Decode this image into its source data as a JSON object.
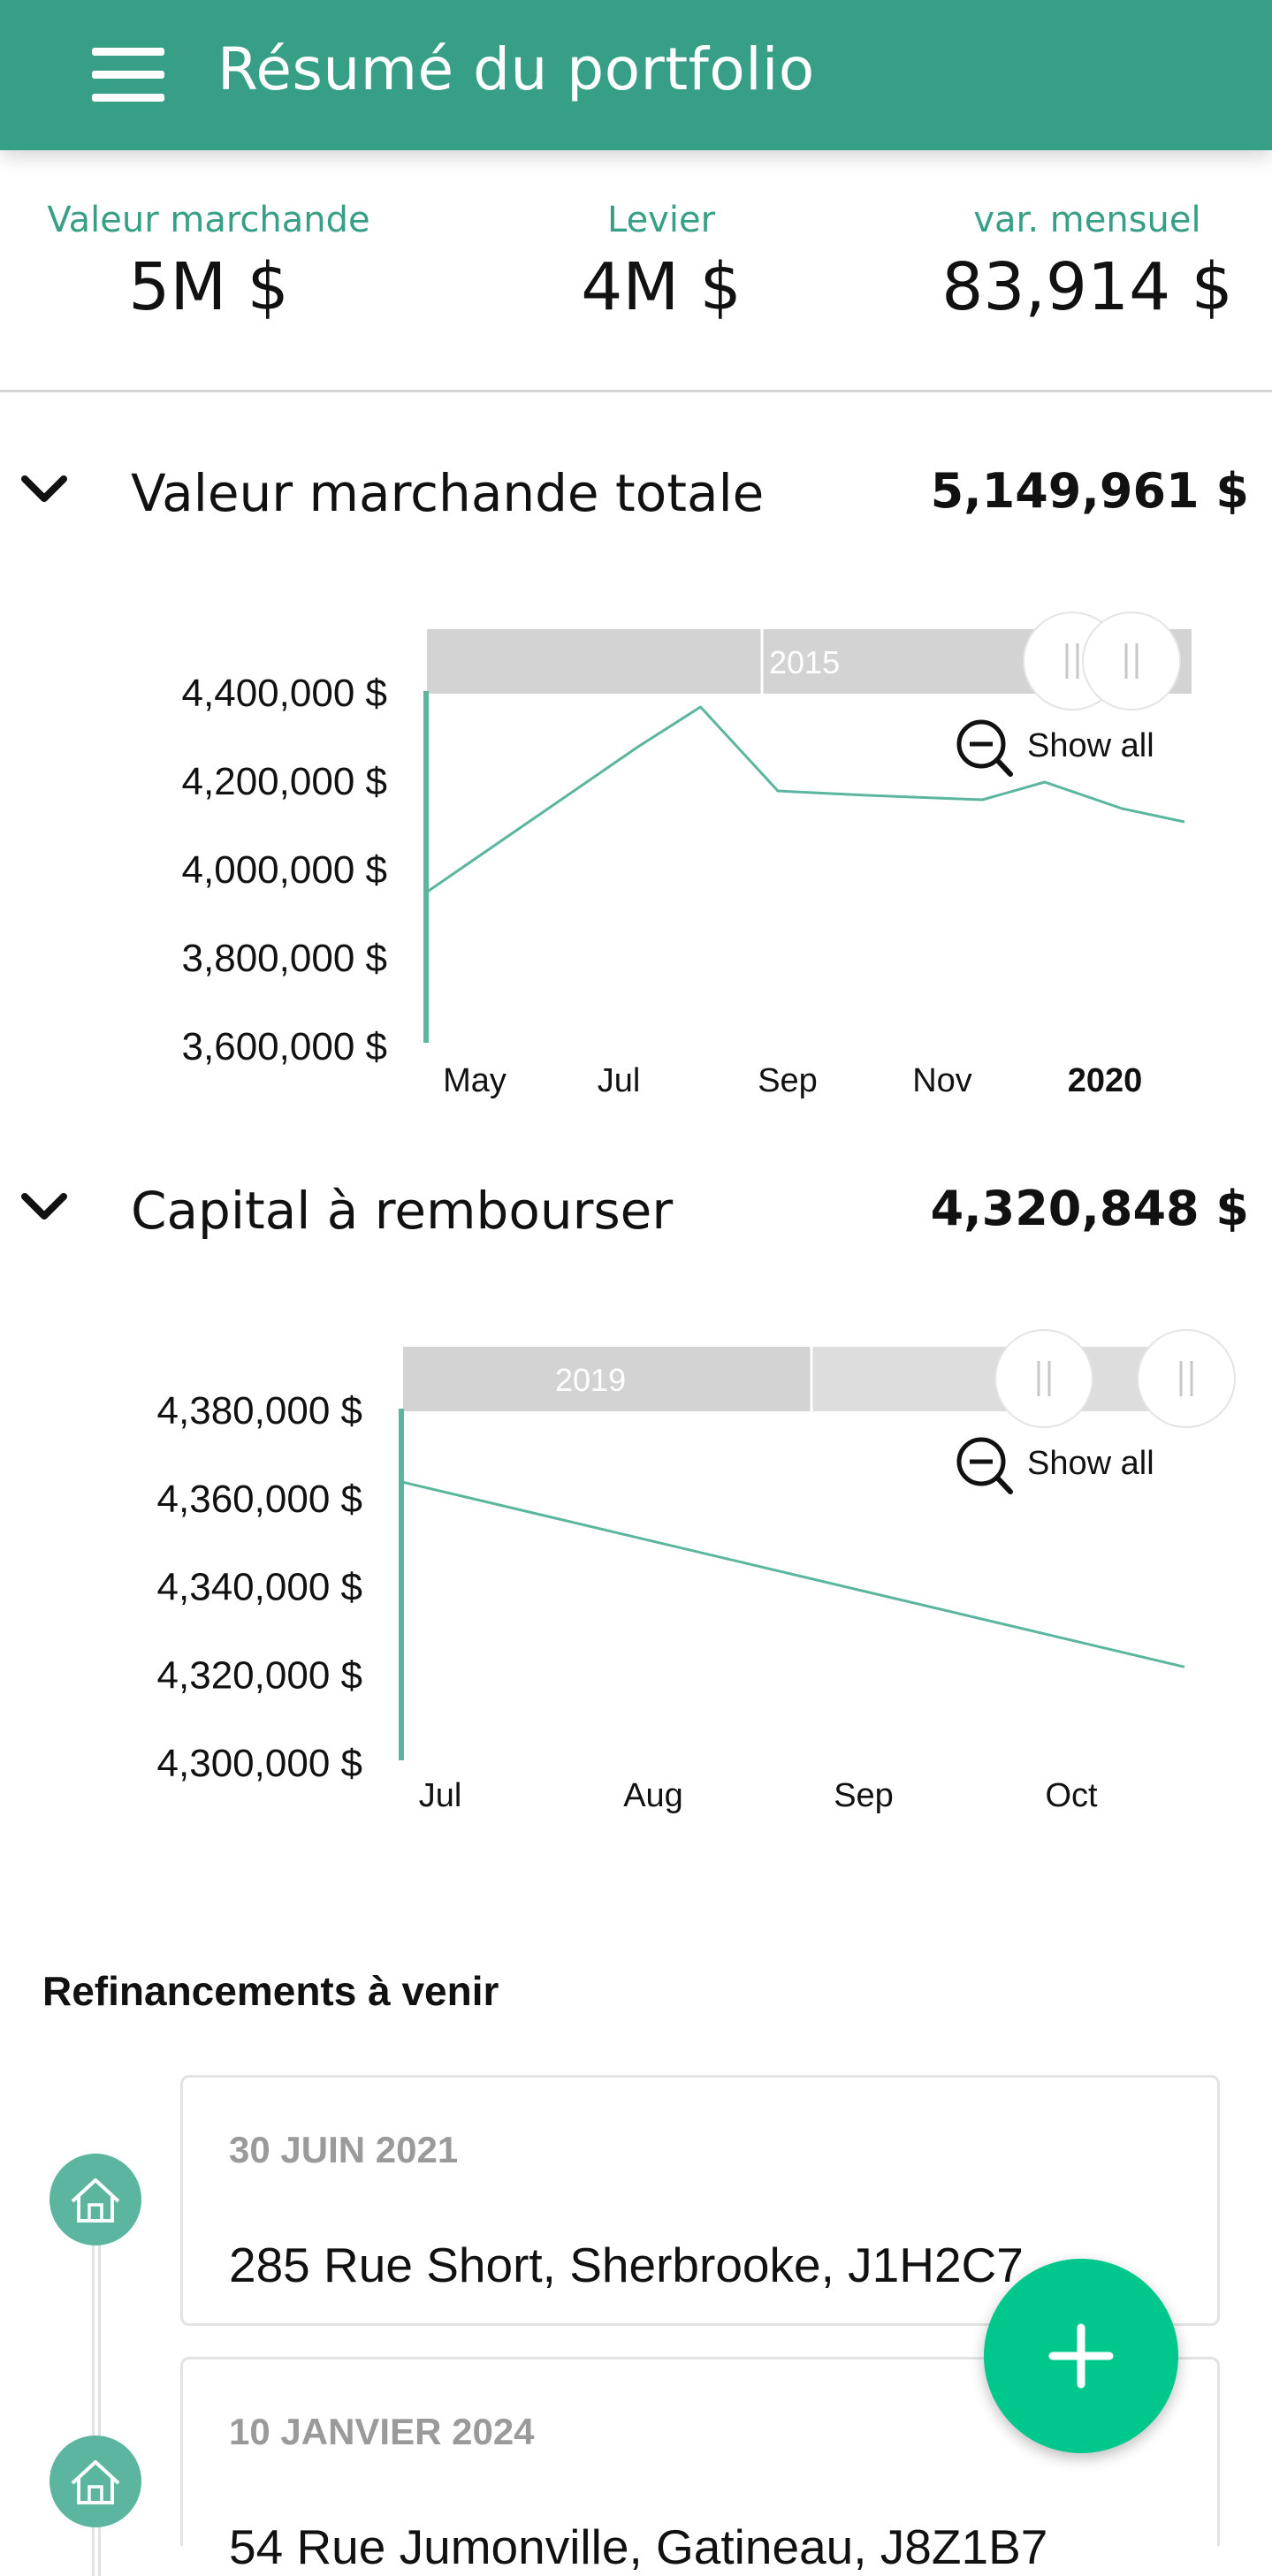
{
  "appbar": {
    "title": "Résumé du portfolio",
    "menu_icon": "menu-icon"
  },
  "summary": [
    {
      "label": "Valeur marchande",
      "value": "5M $"
    },
    {
      "label": "Levier",
      "value": "4M $"
    },
    {
      "label": "var. mensuel",
      "value": "83,914 $"
    }
  ],
  "sections": [
    {
      "title": "Valeur marchande totale",
      "value": "5,149,961 $"
    },
    {
      "title": "Capital à rembourser",
      "value": "4,320,848 $"
    }
  ],
  "colors": {
    "brand": "#369f86",
    "line": "#5bb59f",
    "fab": "#00c88c",
    "navigator": "#d3d3d3"
  },
  "chart_data": [
    {
      "type": "line",
      "title": "",
      "series": [
        {
          "values": [
            3950000,
            4280000,
            4370000,
            4180000,
            4170000,
            4160000,
            4200000,
            4140000,
            4110000
          ]
        }
      ],
      "x": [
        "Apr 1, 2019",
        "Jun 25, 2019",
        "Jul 20, 2019",
        "Aug 20, 2019",
        "Sep 25, 2019",
        "Nov 10, 2019",
        "Dec 5, 2019",
        "Jan 5, 2020",
        "Jan 30, 2020"
      ],
      "x_ticks": [
        "May",
        "Jul",
        "Sep",
        "Nov",
        "2020"
      ],
      "y_ticks": [
        "4,400,000 $",
        "4,200,000 $",
        "4,000,000 $",
        "3,800,000 $",
        "3,600,000 $"
      ],
      "y_tick_values": [
        4400000,
        4200000,
        4000000,
        3800000,
        3600000
      ],
      "ylim": [
        3600000,
        4400000
      ],
      "navigator_label": "2015",
      "zoom_label": "Show all",
      "zoom_icon": "zoom-out-icon"
    },
    {
      "type": "line",
      "title": "",
      "series": [
        {
          "values": [
            4364000,
            4322000
          ]
        }
      ],
      "x": [
        "Jul 1, 2019",
        "Oct 25, 2019"
      ],
      "x_ticks": [
        "Jul",
        "Aug",
        "Sep",
        "Oct"
      ],
      "y_ticks": [
        "4,380,000 $",
        "4,360,000 $",
        "4,340,000 $",
        "4,320,000 $",
        "4,300,000 $"
      ],
      "y_tick_values": [
        4380000,
        4360000,
        4340000,
        4320000,
        4300000
      ],
      "ylim": [
        4300000,
        4380000
      ],
      "navigator_label": "2019",
      "zoom_label": "Show all",
      "zoom_icon": "zoom-out-icon"
    }
  ],
  "refinancing": {
    "title": "Refinancements à venir",
    "items": [
      {
        "date": "30 JUIN 2021",
        "address": "285 Rue Short, Sherbrooke, J1H2C7",
        "icon": "home-icon"
      },
      {
        "date": "10 JANVIER 2024",
        "address": "54 Rue Jumonville, Gatineau, J8Z1B7",
        "icon": "home-icon"
      }
    ]
  },
  "fab": {
    "icon": "plus-icon"
  }
}
